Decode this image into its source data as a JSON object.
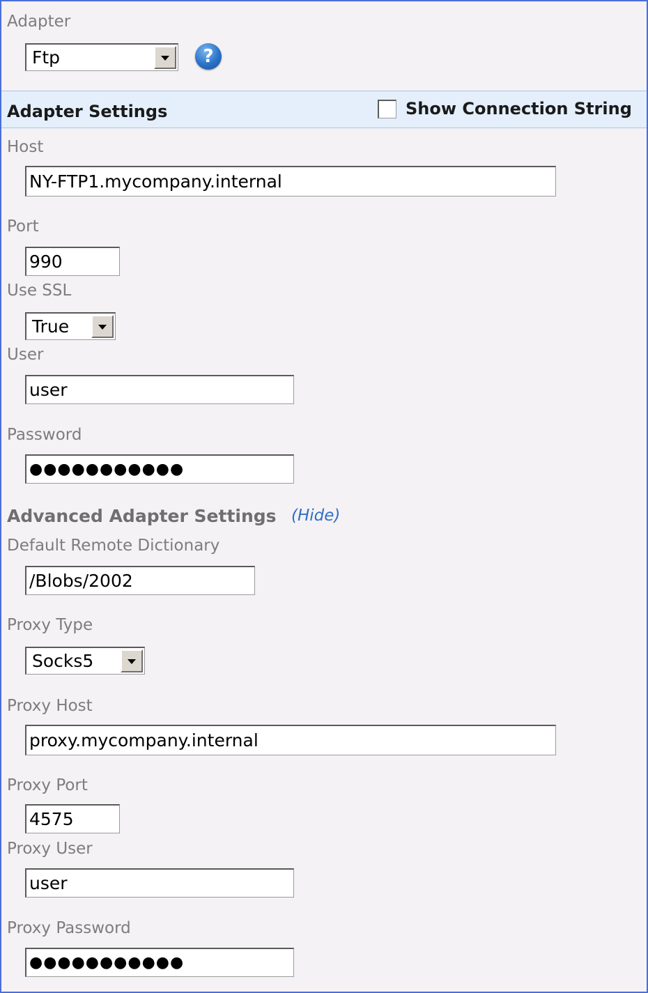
{
  "adapter": {
    "label": "Adapter",
    "selected": "Ftp",
    "help_icon": "question-mark-icon",
    "help_glyph": "?"
  },
  "adapter_settings": {
    "title": "Adapter Settings",
    "show_connection_string_label": "Show Connection String",
    "show_connection_string_checked": false
  },
  "host": {
    "label": "Host",
    "value": "NY-FTP1.mycompany.internal"
  },
  "port": {
    "label": "Port",
    "value": "990"
  },
  "use_ssl": {
    "label": "Use SSL",
    "selected": "True"
  },
  "user": {
    "label": "User",
    "value": "user"
  },
  "password": {
    "label": "Password",
    "value": "●●●●●●●●●●●"
  },
  "advanced": {
    "title": "Advanced Adapter Settings",
    "toggle_label": "(Hide)"
  },
  "default_remote_dictionary": {
    "label": "Default Remote Dictionary",
    "value": "/Blobs/2002"
  },
  "proxy_type": {
    "label": "Proxy Type",
    "selected": "Socks5"
  },
  "proxy_host": {
    "label": "Proxy Host",
    "value": "proxy.mycompany.internal"
  },
  "proxy_port": {
    "label": "Proxy Port",
    "value": "4575"
  },
  "proxy_user": {
    "label": "Proxy User",
    "value": "user"
  },
  "proxy_password": {
    "label": "Proxy Password",
    "value": "●●●●●●●●●●●"
  },
  "colors": {
    "panel_border": "#4a6fd8",
    "panel_background": "#f5f2f5",
    "section_bar": "#e4effb",
    "link": "#2f6fc6"
  }
}
